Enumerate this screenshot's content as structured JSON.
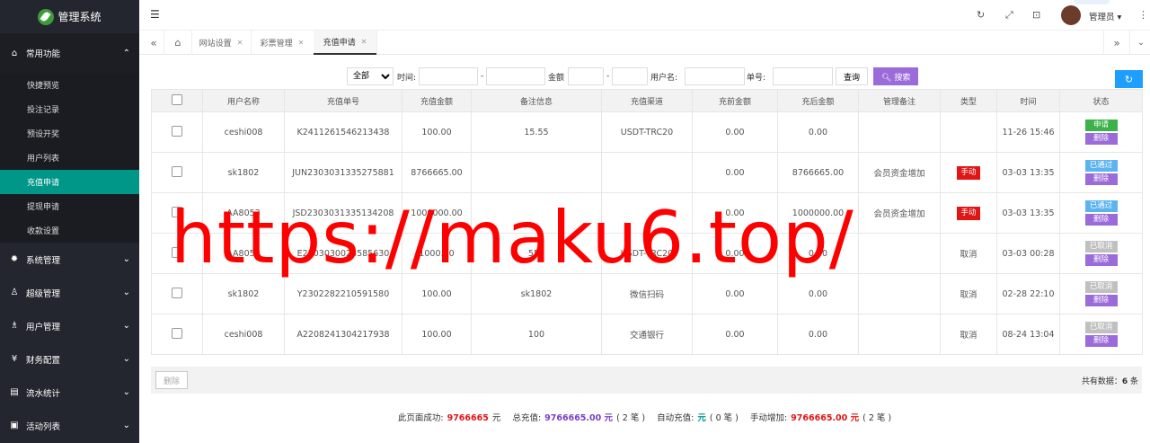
{
  "app": {
    "title": "管理系统"
  },
  "sidebar": {
    "groups": [
      {
        "label": "常用功能",
        "icon": "home-icon",
        "open": true
      },
      {
        "label": "系统管理",
        "icon": "gear-icon"
      },
      {
        "label": "超级管理",
        "icon": "user-icon"
      },
      {
        "label": "用户管理",
        "icon": "users-icon"
      },
      {
        "label": "财务配置",
        "icon": "money-icon"
      },
      {
        "label": "流水统计",
        "icon": "chart-icon"
      },
      {
        "label": "活动列表",
        "icon": "gift-icon"
      }
    ],
    "sub_items": [
      "快捷预览",
      "投注记录",
      "预设开奖",
      "用户列表",
      "充值申请",
      "提现申请",
      "收款设置"
    ]
  },
  "header": {
    "user": "管理员"
  },
  "tabs": [
    {
      "label": "网站设置"
    },
    {
      "label": "彩票管理"
    },
    {
      "label": "充值申请"
    }
  ],
  "filter": {
    "type_selected": "全部",
    "time_label": "时间:",
    "dash": "-",
    "amount_label": "金额",
    "username_label": "用户名:",
    "order_label": "单号:",
    "query_btn": "查询",
    "search_btn": "搜索"
  },
  "table": {
    "headers": [
      "用户名称",
      "充值单号",
      "充值金额",
      "备注信息",
      "充值渠道",
      "充前金额",
      "充后金额",
      "管理备注",
      "类型",
      "时间",
      "状态"
    ],
    "rows": [
      {
        "user": "ceshi008",
        "order": "K2411261546213438",
        "amount": "100.00",
        "note": "15.55",
        "channel": "USDT-TRC20",
        "before": "0.00",
        "after": "0.00",
        "admin_note": "",
        "type": "",
        "time": "11-26 15:46",
        "status": "申请",
        "delete": "删除"
      },
      {
        "user": "sk1802",
        "order": "JUN2303031335275881",
        "amount": "8766665.00",
        "note": "",
        "channel": "",
        "before": "0.00",
        "after": "8766665.00",
        "admin_note": "会员资金增加",
        "type": "手动",
        "time": "03-03 13:35",
        "status": "已通过",
        "delete": "删除"
      },
      {
        "user": "AA8053",
        "order": "JSD2303031335134208",
        "amount": "1000000.00",
        "note": "",
        "channel": "",
        "before": "0.00",
        "after": "1000000.00",
        "admin_note": "会员资金增加",
        "type": "手动",
        "time": "03-03 13:35",
        "status": "已通过",
        "delete": "删除"
      },
      {
        "user": "AA8053",
        "order": "E2303030028585630",
        "amount": "1000.00",
        "note": "555",
        "channel": "USDT-TRC20",
        "before": "0.00",
        "after": "0.00",
        "admin_note": "",
        "type": "取消",
        "time": "03-03 00:28",
        "status": "已取消",
        "delete": "删除"
      },
      {
        "user": "sk1802",
        "order": "Y2302282210591580",
        "amount": "100.00",
        "note": "sk1802",
        "channel": "微信扫码",
        "before": "0.00",
        "after": "0.00",
        "admin_note": "",
        "type": "取消",
        "time": "02-28 22:10",
        "status": "已取消",
        "delete": "删除"
      },
      {
        "user": "ceshi008",
        "order": "A2208241304217938",
        "amount": "100.00",
        "note": "100",
        "channel": "交通银行",
        "before": "0.00",
        "after": "0.00",
        "admin_note": "",
        "type": "取消",
        "time": "08-24 13:04",
        "status": "已取消",
        "delete": "删除"
      }
    ]
  },
  "footer": {
    "delete_btn": "删除",
    "total_label": "共有数据：",
    "total_count": "6",
    "total_unit": "条"
  },
  "summary": {
    "page_success_label": "此页面成功:",
    "page_success_value": "9766665",
    "yuan": "元",
    "total_label": "总充值:",
    "total_value": "9766665.00 元",
    "total_count": "( 2 笔 )",
    "auto_label": "自动充值:",
    "auto_value": "元",
    "auto_count": "( 0 笔 )",
    "manual_label": "手动增加:",
    "manual_value": "9766665.00 元",
    "manual_count": "( 2 笔 )"
  },
  "watermark": "https://maku6.top/",
  "colors": {
    "accent": "#009688",
    "purple": "#9b6bd9",
    "blue": "#1e9fff",
    "red": "#e01616",
    "green": "#3cb34a"
  }
}
